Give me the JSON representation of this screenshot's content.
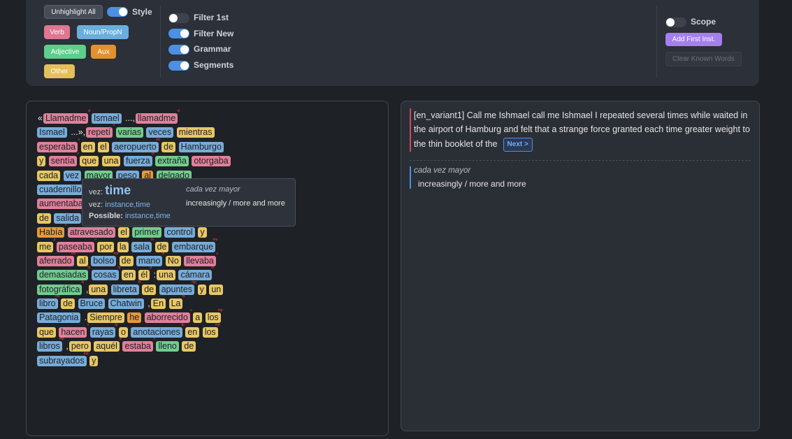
{
  "toolbar": {
    "unhighlight_label": "Unhighlight All",
    "style_label": "Style",
    "verb_label": "Verb",
    "noun_label": "Noun/PropN",
    "adjective_label": "Adjective",
    "aux_label": "Aux",
    "other_label": "Other",
    "filter_first_label": "Filter 1st",
    "filter_new_label": "Filter New",
    "grammar_label": "Grammar",
    "segments_label": "Segments",
    "scope_label": "Scope",
    "add_first_label": "Add First Inst.",
    "clear_known_label": "Clear Known Words"
  },
  "toggles": {
    "style": "on",
    "filter_first": "off",
    "filter_new": "on",
    "grammar": "on",
    "segments": "on",
    "scope": "off"
  },
  "reader": {
    "lines": [
      [
        {
          "p": "«"
        },
        {
          "w": "Llamadme",
          "c": "verb",
          "s": "vl"
        },
        {
          "w": "Ismael",
          "c": "noun"
        },
        {
          "p": "...,"
        },
        {
          "w": "llamadme",
          "c": "verb",
          "s": "vl"
        }
      ],
      [
        {
          "w": "Ismael",
          "c": "noun"
        },
        {
          "p": "...»,"
        },
        {
          "w": "repetí",
          "c": "verb",
          "s": "v"
        },
        {
          "w": "varias",
          "c": "adj"
        },
        {
          "w": "veces",
          "c": "noun"
        },
        {
          "w": "mientras",
          "c": "other"
        }
      ],
      [
        {
          "w": "esperaba",
          "c": "verb",
          "s": "v"
        },
        {
          "w": "en",
          "c": "other"
        },
        {
          "w": "el",
          "c": "other",
          "u": true
        },
        {
          "w": "aeropuerto",
          "c": "noun",
          "s": "ms"
        },
        {
          "w": "de",
          "c": "other"
        },
        {
          "w": "Hamburgo",
          "c": "noun",
          "u": true
        }
      ],
      [
        {
          "w": "y",
          "c": "other"
        },
        {
          "w": "sentía",
          "c": "verb",
          "s": "v"
        },
        {
          "w": "que",
          "c": "other"
        },
        {
          "w": "una",
          "c": "other"
        },
        {
          "w": "fuerza",
          "c": "noun",
          "s": "fs"
        },
        {
          "w": "extraña",
          "c": "adj"
        },
        {
          "w": "otorgaba",
          "c": "verb"
        }
      ],
      [
        {
          "w": "cada",
          "c": "other"
        },
        {
          "w": "vez",
          "c": "noun",
          "u": true
        },
        {
          "w": "mayor",
          "c": "adj",
          "u": true
        },
        {
          "w": "peso",
          "c": "noun"
        },
        {
          "w": "al",
          "c": "aux"
        },
        {
          "w": "delgado",
          "c": "adj"
        }
      ],
      [
        {
          "w": "cuadernillo",
          "c": "noun"
        }
      ],
      [
        {
          "w": "aumentaba",
          "c": "verb"
        }
      ],
      [
        {
          "w": "de",
          "c": "other"
        },
        {
          "w": "salida",
          "c": "noun"
        }
      ],
      [
        {
          "w": "Había",
          "c": "aux",
          "s": "v"
        },
        {
          "w": "atravesado",
          "c": "verb",
          "s": "v"
        },
        {
          "w": "el",
          "c": "other"
        },
        {
          "w": "primer",
          "c": "adj"
        },
        {
          "w": "control",
          "c": "noun",
          "s": "ms"
        },
        {
          "w": "y",
          "c": "other"
        }
      ],
      [
        {
          "w": "me",
          "c": "other",
          "s": "p"
        },
        {
          "w": "paseaba",
          "c": "verb",
          "s": "v"
        },
        {
          "w": "por",
          "c": "other"
        },
        {
          "w": "la",
          "c": "other"
        },
        {
          "w": "sala",
          "c": "noun",
          "s": "fs"
        },
        {
          "w": "de",
          "c": "other"
        },
        {
          "w": "embarque",
          "c": "noun",
          "s": "ms"
        }
      ],
      [
        {
          "w": "aferrado",
          "c": "verb",
          "s": "ms"
        },
        {
          "w": "al",
          "c": "other"
        },
        {
          "w": "bolso",
          "c": "noun",
          "s": "ms"
        },
        {
          "w": "de",
          "c": "other"
        },
        {
          "w": "mano",
          "c": "noun",
          "s": "fs"
        },
        {
          "w": "No",
          "c": "other"
        },
        {
          "w": "llevaba",
          "c": "verb",
          "s": "v"
        }
      ],
      [
        {
          "w": "demasiadas",
          "c": "adj",
          "s": "fp"
        },
        {
          "w": "cosas",
          "c": "noun",
          "s": "fp"
        },
        {
          "w": "en",
          "c": "other"
        },
        {
          "w": "él",
          "c": "other",
          "s": "p"
        },
        {
          "p": ":"
        },
        {
          "w": "una",
          "c": "other"
        },
        {
          "w": "cámara",
          "c": "noun",
          "s": "fs"
        }
      ],
      [
        {
          "w": "fotográfica",
          "c": "adj",
          "s": "fs"
        },
        {
          "p": ","
        },
        {
          "w": "una",
          "c": "other"
        },
        {
          "w": "libreta",
          "c": "noun",
          "s": "fs"
        },
        {
          "w": "de",
          "c": "other"
        },
        {
          "w": "apuntes",
          "c": "noun",
          "s": "mp"
        },
        {
          "w": "y",
          "c": "other"
        },
        {
          "w": "un",
          "c": "other"
        }
      ],
      [
        {
          "w": "libro",
          "c": "noun",
          "s": "ms"
        },
        {
          "w": "de",
          "c": "other"
        },
        {
          "w": "Bruce",
          "c": "noun"
        },
        {
          "w": "Chatwin",
          "c": "noun"
        },
        {
          "p": ","
        },
        {
          "w": "En",
          "c": "other"
        },
        {
          "w": "La",
          "c": "other",
          "s": "fs"
        }
      ],
      [
        {
          "w": "Patagonia",
          "c": "noun"
        },
        {
          "p": "."
        },
        {
          "w": "Siempre",
          "c": "other"
        },
        {
          "w": "he",
          "c": "aux"
        },
        {
          "w": "aborrecido",
          "c": "verb",
          "s": "v"
        },
        {
          "w": "a",
          "c": "other"
        },
        {
          "w": "los",
          "c": "other",
          "s": "mp"
        }
      ],
      [
        {
          "w": "que",
          "c": "other"
        },
        {
          "w": "hacen",
          "c": "verb",
          "s": "v"
        },
        {
          "w": "rayas",
          "c": "noun",
          "s": "fp"
        },
        {
          "w": "o",
          "c": "other"
        },
        {
          "w": "anotaciones",
          "c": "noun",
          "s": "fp"
        },
        {
          "w": "en",
          "c": "other"
        },
        {
          "w": "los",
          "c": "other",
          "s": "mp"
        }
      ],
      [
        {
          "w": "libros",
          "c": "noun",
          "s": "mp"
        },
        {
          "p": ","
        },
        {
          "w": "pero",
          "c": "other"
        },
        {
          "w": "aquél",
          "c": "other",
          "s": "p"
        },
        {
          "w": "estaba",
          "c": "verb",
          "s": "v"
        },
        {
          "w": "lleno",
          "c": "adj"
        },
        {
          "w": "de",
          "c": "other"
        }
      ],
      [
        {
          "w": "subrayados",
          "c": "noun",
          "s": "mp"
        },
        {
          "w": "y",
          "c": "other"
        }
      ]
    ]
  },
  "tooltip": {
    "lemma_prefix": "vez:",
    "headword": "time",
    "gloss_prefix": "vez:",
    "gloss": "instance,time",
    "possible_label": "Possible:",
    "possible": "instance,time",
    "phrase": "cada vez mayor",
    "phrase_translation": "increasingly / more and more"
  },
  "translation": {
    "variant_text": "[en_variant1] Call me Ishmael call me Ishmael I repeated several times while waited in the airport of Hamburg and felt that a strange force granted each time greater weight to the thin booklet of the",
    "next_label": "Next >",
    "phrase": "cada vez mayor",
    "phrase_translation": "increasingly / more and more"
  }
}
